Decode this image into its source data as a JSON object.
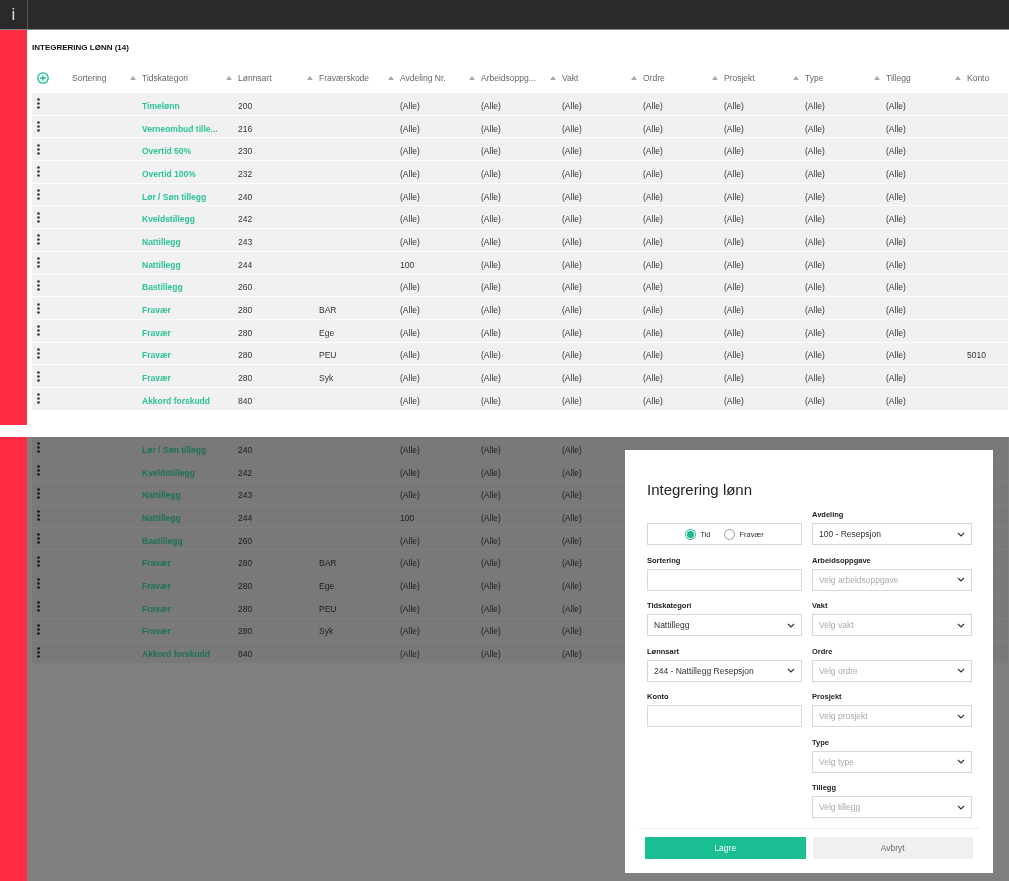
{
  "top_bar": {
    "icon_text": "i"
  },
  "table": {
    "title": "INTEGRERING LØNN (14)",
    "columns": [
      {
        "label": "Sortering",
        "kind": "text"
      },
      {
        "label": "Tidskategori",
        "kind": "link"
      },
      {
        "label": "Lønnsart",
        "kind": "text"
      },
      {
        "label": "Fraværskode",
        "kind": "text"
      },
      {
        "label": "Avdeling Nr.",
        "kind": "text"
      },
      {
        "label": "Arbeidsoppg...",
        "kind": "text"
      },
      {
        "label": "Vakt",
        "kind": "text"
      },
      {
        "label": "Ordre",
        "kind": "text"
      },
      {
        "label": "Prosjekt",
        "kind": "text"
      },
      {
        "label": "Type",
        "kind": "text"
      },
      {
        "label": "Tillegg",
        "kind": "text"
      },
      {
        "label": "Konto",
        "kind": "text"
      }
    ],
    "rows": [
      {
        "cells": [
          "",
          "Timelønn",
          "200",
          "",
          "(Alle)",
          "(Alle)",
          "(Alle)",
          "(Alle)",
          "(Alle)",
          "(Alle)",
          "(Alle)",
          ""
        ]
      },
      {
        "cells": [
          "",
          "Verneombud tille...",
          "216",
          "",
          "(Alle)",
          "(Alle)",
          "(Alle)",
          "(Alle)",
          "(Alle)",
          "(Alle)",
          "(Alle)",
          ""
        ]
      },
      {
        "cells": [
          "",
          "Overtid 50%",
          "230",
          "",
          "(Alle)",
          "(Alle)",
          "(Alle)",
          "(Alle)",
          "(Alle)",
          "(Alle)",
          "(Alle)",
          ""
        ]
      },
      {
        "cells": [
          "",
          "Overtid 100%",
          "232",
          "",
          "(Alle)",
          "(Alle)",
          "(Alle)",
          "(Alle)",
          "(Alle)",
          "(Alle)",
          "(Alle)",
          ""
        ]
      },
      {
        "cells": [
          "",
          "Lør / Søn tillegg",
          "240",
          "",
          "(Alle)",
          "(Alle)",
          "(Alle)",
          "(Alle)",
          "(Alle)",
          "(Alle)",
          "(Alle)",
          ""
        ]
      },
      {
        "cells": [
          "",
          "Kveldstillegg",
          "242",
          "",
          "(Alle)",
          "(Alle)",
          "(Alle)",
          "(Alle)",
          "(Alle)",
          "(Alle)",
          "(Alle)",
          ""
        ]
      },
      {
        "cells": [
          "",
          "Nattillegg",
          "243",
          "",
          "(Alle)",
          "(Alle)",
          "(Alle)",
          "(Alle)",
          "(Alle)",
          "(Alle)",
          "(Alle)",
          ""
        ]
      },
      {
        "cells": [
          "",
          "Nattillegg",
          "244",
          "",
          "100",
          "(Alle)",
          "(Alle)",
          "(Alle)",
          "(Alle)",
          "(Alle)",
          "(Alle)",
          ""
        ]
      },
      {
        "cells": [
          "",
          "Bastillegg",
          "260",
          "",
          "(Alle)",
          "(Alle)",
          "(Alle)",
          "(Alle)",
          "(Alle)",
          "(Alle)",
          "(Alle)",
          ""
        ]
      },
      {
        "cells": [
          "",
          "Fravær",
          "280",
          "BAR",
          "(Alle)",
          "(Alle)",
          "(Alle)",
          "(Alle)",
          "(Alle)",
          "(Alle)",
          "(Alle)",
          ""
        ]
      },
      {
        "cells": [
          "",
          "Fravær",
          "280",
          "Ege",
          "(Alle)",
          "(Alle)",
          "(Alle)",
          "(Alle)",
          "(Alle)",
          "(Alle)",
          "(Alle)",
          ""
        ]
      },
      {
        "cells": [
          "",
          "Fravær",
          "280",
          "PEU",
          "(Alle)",
          "(Alle)",
          "(Alle)",
          "(Alle)",
          "(Alle)",
          "(Alle)",
          "(Alle)",
          "5010"
        ]
      },
      {
        "cells": [
          "",
          "Fravær",
          "280",
          "Syk",
          "(Alle)",
          "(Alle)",
          "(Alle)",
          "(Alle)",
          "(Alle)",
          "(Alle)",
          "(Alle)",
          ""
        ]
      },
      {
        "cells": [
          "",
          "Akkord forskudd",
          "840",
          "",
          "(Alle)",
          "(Alle)",
          "(Alle)",
          "(Alle)",
          "(Alle)",
          "(Alle)",
          "(Alle)",
          ""
        ]
      }
    ]
  },
  "background_view": {
    "rows": [
      {
        "cells": [
          "",
          "Lør / Søn tillegg",
          "240",
          "",
          "(Alle)",
          "(Alle)",
          "(Alle)"
        ]
      },
      {
        "cells": [
          "",
          "Kveldstillegg",
          "242",
          "",
          "(Alle)",
          "(Alle)",
          "(Alle)"
        ]
      },
      {
        "cells": [
          "",
          "Nattillegg",
          "243",
          "",
          "(Alle)",
          "(Alle)",
          "(Alle)"
        ]
      },
      {
        "cells": [
          "",
          "Nattillegg",
          "244",
          "",
          "100",
          "(Alle)",
          "(Alle)"
        ]
      },
      {
        "cells": [
          "",
          "Bastillegg",
          "260",
          "",
          "(Alle)",
          "(Alle)",
          "(Alle)"
        ]
      },
      {
        "cells": [
          "",
          "Fravær",
          "280",
          "BAR",
          "(Alle)",
          "(Alle)",
          "(Alle)"
        ]
      },
      {
        "cells": [
          "",
          "Fravær",
          "280",
          "Ege",
          "(Alle)",
          "(Alle)",
          "(Alle)"
        ]
      },
      {
        "cells": [
          "",
          "Fravær",
          "280",
          "PEU",
          "(Alle)",
          "(Alle)",
          "(Alle)"
        ]
      },
      {
        "cells": [
          "",
          "Fravær",
          "280",
          "Syk",
          "(Alle)",
          "(Alle)",
          "(Alle)"
        ]
      },
      {
        "cells": [
          "",
          "Akkord forskudd",
          "840",
          "",
          "(Alle)",
          "(Alle)",
          "(Alle)"
        ]
      }
    ]
  },
  "dialog": {
    "title": "Integrering lønn",
    "columns": [
      [
        {
          "kind": "radio",
          "options": [
            {
              "label": "Tid",
              "selected": true
            },
            {
              "label": "Fravær",
              "selected": false
            }
          ]
        },
        {
          "kind": "text",
          "label": "Sortering"
        },
        {
          "kind": "select",
          "label": "Tidskategori",
          "value": "Nattillegg"
        },
        {
          "kind": "select",
          "label": "Lønnsart",
          "value": "244 - Nattillegg Resepsjon"
        },
        {
          "kind": "text",
          "label": "Konto"
        }
      ],
      [
        {
          "kind": "select",
          "label": "Avdeling",
          "value": "100 - Resepsjon"
        },
        {
          "kind": "select",
          "label": "Arbeidsoppgave",
          "placeholder": "Velg arbeidsoppgave"
        },
        {
          "kind": "select",
          "label": "Vakt",
          "placeholder": "Velg vakt"
        },
        {
          "kind": "select",
          "label": "Ordre",
          "placeholder": "Velg ordre"
        },
        {
          "kind": "select",
          "label": "Prosjekt",
          "placeholder": "Velg prosjekt"
        },
        {
          "kind": "select",
          "label": "Type",
          "placeholder": "Velg type"
        },
        {
          "kind": "select",
          "label": "Tillegg",
          "placeholder": "Velg tillegg"
        }
      ]
    ],
    "buttons": [
      {
        "label": "Lagre",
        "kind": "primary"
      },
      {
        "label": "Avbryt",
        "kind": "secondary"
      }
    ]
  }
}
